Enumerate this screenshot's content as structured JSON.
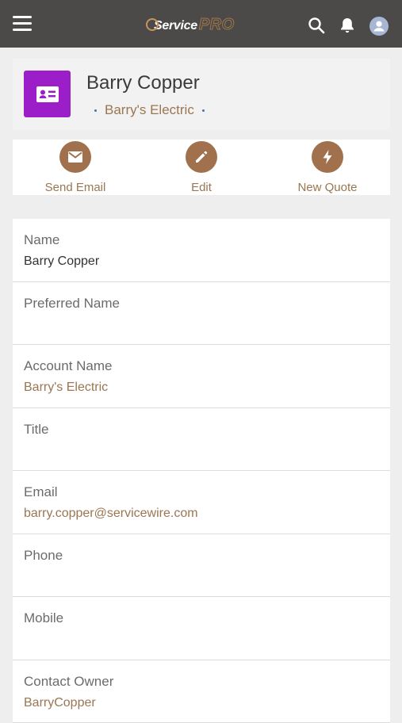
{
  "header": {
    "logo_prefix": "Service",
    "logo_suffix": "PRO"
  },
  "contact": {
    "name": "Barry Copper",
    "account": "Barry's Electric"
  },
  "actions": [
    {
      "label": "Send Email",
      "icon": "envelope-icon"
    },
    {
      "label": "Edit",
      "icon": "pencil-icon"
    },
    {
      "label": "New Quote",
      "icon": "lightning-icon"
    }
  ],
  "fields": [
    {
      "label": "Name",
      "value": "Barry Copper",
      "link": false
    },
    {
      "label": "Preferred Name",
      "value": "",
      "link": false
    },
    {
      "label": "Account Name",
      "value": "Barry's Electric",
      "link": true
    },
    {
      "label": "Title",
      "value": "",
      "link": false
    },
    {
      "label": "Email",
      "value": "barry.copper@servicewire.com",
      "link": true
    },
    {
      "label": "Phone",
      "value": "",
      "link": false
    },
    {
      "label": "Mobile",
      "value": "",
      "link": false
    },
    {
      "label": "Contact Owner",
      "value": "BarryCopper",
      "link": true
    }
  ],
  "colors": {
    "topbar": "#4b4a48",
    "accent": "#9a7652",
    "action_circle": "#a0714c",
    "badge": "#9c1ec8"
  }
}
